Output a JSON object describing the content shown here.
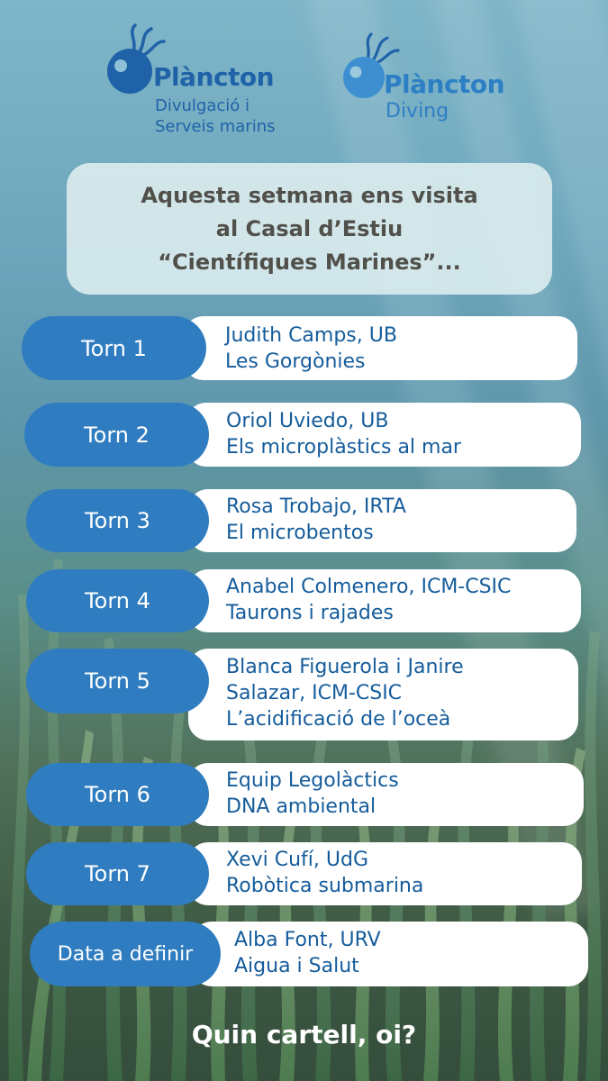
{
  "logos": {
    "left": {
      "brand": "Plàncton",
      "subtitle_line1": "Divulgació i",
      "subtitle_line2": "Serveis marins",
      "icon": "jellyfish-icon"
    },
    "right": {
      "brand": "Plàncton",
      "subtitle": "Diving",
      "icon": "jellyfish-icon"
    }
  },
  "headline": {
    "line1": "Aquesta setmana ens visita",
    "line2": "al Casal d’Estiu",
    "line3": "“Científiques Marines”..."
  },
  "schedule": [
    {
      "label": "Torn 1",
      "lines": [
        "Judith Camps, UB",
        "Les Gorgònies"
      ]
    },
    {
      "label": "Torn 2",
      "lines": [
        "Oriol Uviedo, UB",
        "Els microplàstics al mar"
      ]
    },
    {
      "label": "Torn 3",
      "lines": [
        "Rosa Trobajo, IRTA",
        "El microbentos"
      ]
    },
    {
      "label": "Torn 4",
      "lines": [
        "Anabel Colmenero, ICM-CSIC",
        "Taurons i rajades"
      ]
    },
    {
      "label": "Torn 5",
      "lines": [
        "Blanca Figuerola i Janire",
        "Salazar, ICM-CSIC",
        "L’acidificació de l’oceà"
      ]
    },
    {
      "label": "Torn 6",
      "lines": [
        "Equip Legolàctics",
        "DNA ambiental"
      ]
    },
    {
      "label": "Torn 7",
      "lines": [
        "Xevi Cufí, UdG",
        "Robòtica submarina"
      ]
    },
    {
      "label": "Data a definir",
      "lines": [
        "Alba Font, URV",
        "Aigua i Salut"
      ]
    }
  ],
  "footer": {
    "text": "Quin cartell, oi?"
  },
  "colors": {
    "pill": "#2f7dc0",
    "card": "#ffffff",
    "text_blue": "#155c9b",
    "brand_blue": "#1f62a8",
    "headline_bg": "#daebee",
    "headline_text": "#51504a"
  }
}
